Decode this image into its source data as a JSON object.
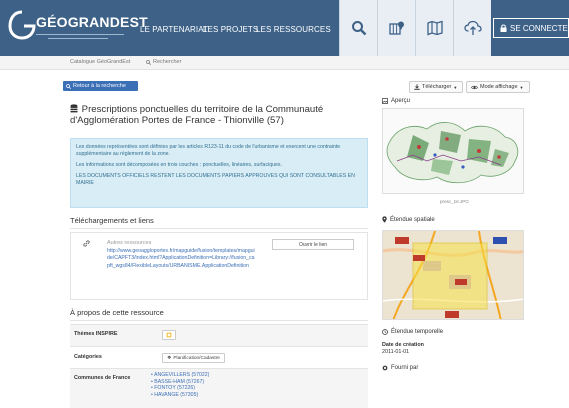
{
  "header": {
    "logo_text": "GÉOGRANDEST",
    "nav": [
      "LE PARTENARIAT",
      "LES PROJETS",
      "LES RESSOURCES"
    ],
    "connect_label": "SE CONNECTER",
    "icons": [
      "search-icon",
      "map-marker-grid-icon",
      "map-icon",
      "cloud-upload-icon",
      "lock-icon"
    ],
    "colors": {
      "header_bg": "#3d6187",
      "icon_bg": "#e9eef4",
      "link_blue": "#3b6fb6",
      "info_bg": "#d9edf7"
    }
  },
  "breadcrumb": {
    "catalog": "Catalogue GéoGrandEst",
    "search": "Rechercher"
  },
  "toolbar": {
    "back_label": "Retour à la recherche",
    "download_label": "Télécharger",
    "display_mode_label": "Mode affichage"
  },
  "record": {
    "title": "Prescriptions ponctuelles du territoire de la Communauté d'Agglomération Portes de France - Thionville (57)",
    "abstract_p1": "Les données représentées sont définies par les articles R123-11 du code de l'urbanisme et exercent une contrainte supplémentaire au règlement de la zone.",
    "abstract_p2": "Les informations sont décomposées en trois couches : ponctuelles, linéaires, surfaciques.",
    "abstract_p3": "LES DOCUMENTS OFFICIELS RESTENT LES DOCUMENTS PAPIERS APPROUVES QUI SONT CONSULTABLES EN MAIRIE"
  },
  "downloads": {
    "section_title": "Téléchargements et liens",
    "resource_label": "Autres ressources",
    "resource_url": "http://www.geoaggloportes.fr/mapguide/fusion/templates/mapguide/CAPFT3/index.html?ApplicationDefinition=Library://fusion_capft_wgs84/FlexibleLayouts/URBANISME.ApplicationDefinition",
    "open_link_label": "Ouvrir le lien"
  },
  "about": {
    "section_title": "À propos de cette ressource",
    "inspire_label": "Thèmes INSPIRE",
    "categories_label": "Catégories",
    "category_tag": "Planification/Cadastre",
    "communes_label": "Communes de France",
    "communes": [
      "ANGEVILLERS (57022)",
      "BASSE-HAM (57267)",
      "FONTOY (57226)",
      "HAVANGE (57305)"
    ]
  },
  "sidebar": {
    "preview_label": "Aperçu",
    "preview_caption": "presc_txt.JPG",
    "extent_label": "Étendue spatiale",
    "temporal_label": "Étendue temporelle",
    "creation_date_title": "Date de création",
    "creation_date": "2011-01-01",
    "provided_by_label": "Fourni par"
  }
}
